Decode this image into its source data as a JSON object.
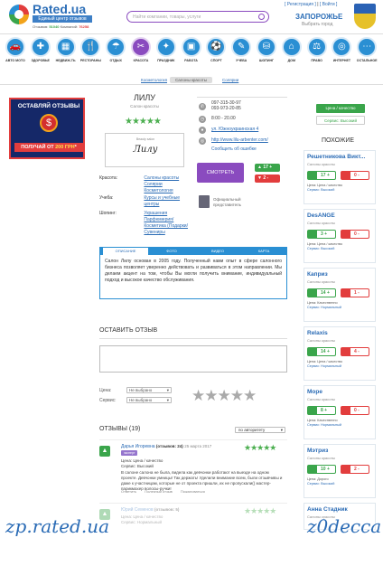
{
  "header": {
    "logo_text": "Rated.ua",
    "logo_sub": "Единый центр отзывов",
    "stats_reviews_label": "Отзывов:",
    "stats_reviews": "51040",
    "stats_companies_label": "Компаний:",
    "stats_companies": "76258",
    "search_placeholder": "Найти компании, товары, услуги",
    "register": "[ Регистрация ]",
    "login": "[ Войти ]",
    "city": "ЗАПОРОЖЬЕ",
    "city_sub": "Выбрать город"
  },
  "categories": [
    {
      "label": "АВТО МОТО",
      "icon": "car-icon",
      "glyph": "🚗"
    },
    {
      "label": "ЗДОРОВЬЕ",
      "icon": "health-icon",
      "glyph": "✚"
    },
    {
      "label": "НЕДВИЖ-ТЬ",
      "icon": "building-icon",
      "glyph": "▦"
    },
    {
      "label": "РЕСТОРАНЫ",
      "icon": "restaurant-icon",
      "glyph": "🍴"
    },
    {
      "label": "ОТДЫХ",
      "icon": "leisure-icon",
      "glyph": "☂"
    },
    {
      "label": "КРАСОТА",
      "icon": "scissors-icon",
      "glyph": "✂"
    },
    {
      "label": "ПРАЗДНИК",
      "icon": "party-icon",
      "glyph": "✦"
    },
    {
      "label": "РАБОТА",
      "icon": "briefcase-icon",
      "glyph": "▣"
    },
    {
      "label": "СПОРТ",
      "icon": "sport-icon",
      "glyph": "⚽"
    },
    {
      "label": "УЧЕБА",
      "icon": "study-icon",
      "glyph": "✎"
    },
    {
      "label": "ШОПИНГ",
      "icon": "shopping-icon",
      "glyph": "⛁"
    },
    {
      "label": "ДОМ",
      "icon": "home-icon",
      "glyph": "⌂"
    },
    {
      "label": "ПРАВО",
      "icon": "law-icon",
      "glyph": "⚖"
    },
    {
      "label": "ИНТЕРНЕТ",
      "icon": "internet-icon",
      "glyph": "◎"
    },
    {
      "label": "ОСТАЛЬНОЕ",
      "icon": "other-icon",
      "glyph": "⋯"
    }
  ],
  "subnav": {
    "crumb1": "Косметология",
    "crumb2": "Салоны красоты",
    "crumb3": "Солярии"
  },
  "ad": {
    "top": "ОСТАВЛЯЙ ОТЗЫВЫ",
    "coin": "$",
    "bottom_pre": "ПОЛУЧАЙ ОТ ",
    "bottom_amount": "200 ГРН",
    "bottom_post": "*"
  },
  "business": {
    "name": "ЛИЛУ",
    "category": "Салон красоты",
    "logo_top": "Beauty salon",
    "logo_name": "Лилу",
    "rating": "★★★★★"
  },
  "info": {
    "beauty_label": "Красота:",
    "beauty_values": [
      "Салоны красоты",
      "Солярии",
      "Косметология"
    ],
    "study_label": "Учеба:",
    "study_values": [
      "Курсы и учебные",
      "центры"
    ],
    "shop_label": "Шопинг:",
    "shop_values": [
      "Украшения",
      "Парфюмерия/",
      "Косметика (Подарки/",
      "Сувениры"
    ]
  },
  "contacts": {
    "phone1": "097-315-30-97",
    "phone2": "093-973-20-85",
    "hours": "8:00 - 20.00",
    "address": "ул. Южноукраинская 4",
    "site": "http://www.lilu-arbenter.com/",
    "report": "Сообщить об ошибке"
  },
  "rate_button": "СМОТРЕТЬ ОТЗЫВЫ",
  "votes": {
    "up": "17 +",
    "down": "2 -"
  },
  "rep": {
    "line1": "Официальный",
    "line2": "представитель"
  },
  "tabs": [
    "ОПИСАНИЕ",
    "ФОТО",
    "ВИДЕО",
    "КАРТА"
  ],
  "description": "Салон Лилу основан в 2005 году. Полученный нами опыт в сфере салонного бизнеса позволяет уверенно действовать и развиваться в этом направлении. Мы делаем акцент на том, чтобы Вы могли получить внимание, индивидуальный подход и высокое качество обслуживания.",
  "review_form": {
    "title": "ОСТАВИТЬ ОТЗЫВ",
    "price_label": "Цена:",
    "price_value": "Не выбрано",
    "service_label": "Сервис:",
    "service_value": "Не выбрано",
    "send": "Отправить"
  },
  "reviews_section": {
    "title": "ОТЗЫВЫ (19)",
    "sort": "по авторитету"
  },
  "reviews": [
    {
      "name": "Дарья Игоревна",
      "count": "(отзывов: 24)",
      "date": "25 марта 2017",
      "badge": "эксперт",
      "price": "Цена: Цена / качество",
      "service": "Сервис: Высокий",
      "text": "В салоне салона не была, видела как девчонки работают на выезде на одном проекте. Девчонки умницы! Так держать! Уделили внимание всем, были отзывчивы и даже к участницам, которые не от проекта пришли, их не пропускали(( мастер-парикмахер волосы-ручки!",
      "foot": [
        "Ответить",
        "Полезный отзыв",
        "Пожаловаться"
      ]
    },
    {
      "name": "Юрий Семенов",
      "count": "(отзывов: 5)",
      "date": "",
      "badge": "",
      "price": "Цена: Цена / качество",
      "service": "Сервис: Нормальный",
      "text": "",
      "foot": []
    }
  ],
  "right": {
    "btn1": "Цена / качество",
    "btn2": "Сервис: Высокий",
    "similar_title": "ПОХОЖИЕ",
    "cards": [
      {
        "name": "Решетникова Викт...",
        "cat": "Салоны красоты",
        "up": "17 +",
        "down": "0 -",
        "price": "Цена: Цена / качество",
        "service": "Сервис: Высокий"
      },
      {
        "name": "DesANGE",
        "cat": "Салоны красоты",
        "up": "3 +",
        "down": "0 -",
        "price": "Цена: Цена / качество",
        "service": "Сервис: Высокий"
      },
      {
        "name": "Каприз",
        "cat": "Салоны красоты",
        "up": "14 +",
        "down": "1 -",
        "price": "Цена: Качественно",
        "service": "Сервис: Нормальный"
      },
      {
        "name": "Relaxis",
        "cat": "Салоны красоты",
        "up": "14 +",
        "down": "4 -",
        "price": "Цена: Цена / качество",
        "service": "Сервис: Нормальный"
      },
      {
        "name": "Море",
        "cat": "Салоны красоты",
        "up": "8 +",
        "down": "0 -",
        "price": "Цена: Качественно",
        "service": "Сервис: Нормальный"
      },
      {
        "name": "Мэтриз",
        "cat": "Салоны красоты",
        "up": "10 +",
        "down": "2 -",
        "price": "Цена: Дорого",
        "service": "Сервис: Высокий"
      },
      {
        "name": "Анна Стадник",
        "cat": "Салоны красоты",
        "up": "3 +",
        "down": "0 -",
        "price": "",
        "service": ""
      }
    ]
  },
  "watermarks": {
    "left": "zp.rated.ua",
    "right": "z0decca"
  }
}
